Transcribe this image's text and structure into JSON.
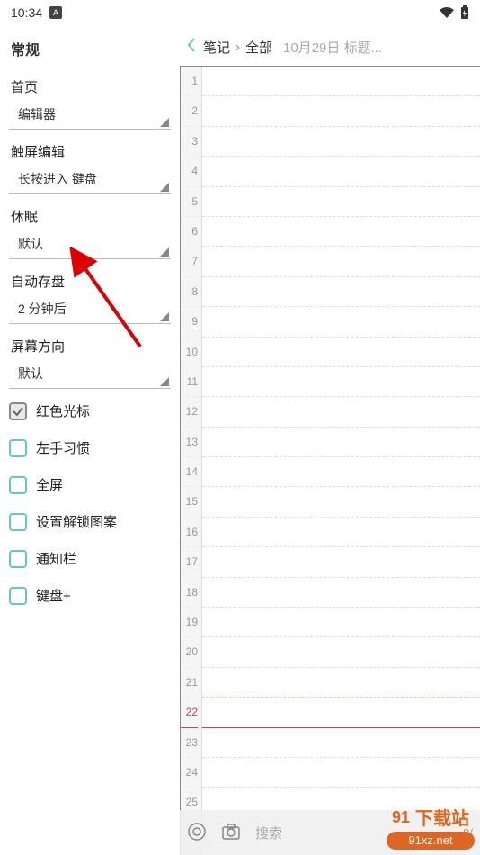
{
  "status": {
    "time": "10:34",
    "iconLabel": "A"
  },
  "sidebar": {
    "title": "常规",
    "settings": [
      {
        "label": "首页",
        "value": "编辑器"
      },
      {
        "label": "触屏编辑",
        "value": "长按进入 键盘"
      },
      {
        "label": "休眠",
        "value": "默认"
      },
      {
        "label": "自动存盘",
        "value": "2 分钟后"
      },
      {
        "label": "屏幕方向",
        "value": "默认"
      }
    ],
    "checkboxes": [
      {
        "label": "红色光标",
        "checked": true
      },
      {
        "label": "左手习惯",
        "checked": false
      },
      {
        "label": "全屏",
        "checked": false
      },
      {
        "label": "设置解锁图案",
        "checked": false
      },
      {
        "label": "通知栏",
        "checked": false
      },
      {
        "label": "键盘+",
        "checked": false
      }
    ]
  },
  "breadcrumb": {
    "part1": "笔记",
    "part2": "全部",
    "info": "10月29日 标题..."
  },
  "editor": {
    "lineCount": 26,
    "currentLine": 22
  },
  "bottomBar": {
    "search": "搜索",
    "page": "8/"
  },
  "watermark": {
    "line1": "下载站",
    "line2": "91xz.net"
  }
}
